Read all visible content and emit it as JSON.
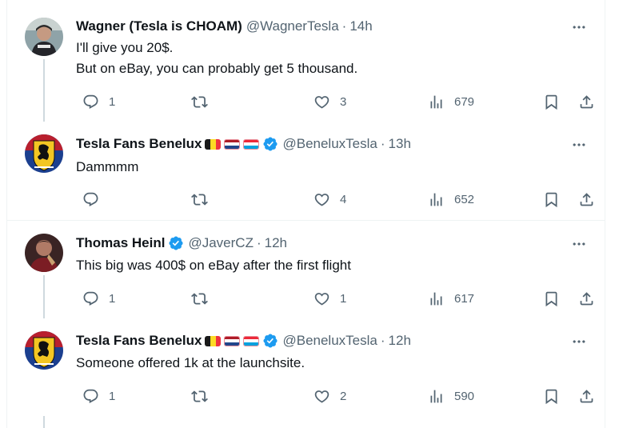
{
  "tweets": [
    {
      "name": "Wagner (Tesla is CHOAM)",
      "handle": "@WagnerTesla",
      "separator": "·",
      "time": "14h",
      "text": "I'll give you 20$.\nBut on eBay, you can probably get 5 thousand.",
      "replies": "1",
      "retweets": "",
      "likes": "3",
      "views": "679"
    },
    {
      "name": "Tesla Fans Benelux",
      "handle": "@BeneluxTesla",
      "separator": "·",
      "time": "13h",
      "text": "Dammmm",
      "replies": "",
      "retweets": "",
      "likes": "4",
      "views": "652"
    },
    {
      "name": "Thomas Heinl",
      "handle": "@JaverCZ",
      "separator": "·",
      "time": "12h",
      "text": "This big was 400$ on eBay after the first flight",
      "replies": "1",
      "retweets": "",
      "likes": "1",
      "views": "617"
    },
    {
      "name": "Tesla Fans Benelux",
      "handle": "@BeneluxTesla",
      "separator": "·",
      "time": "12h",
      "text": "Someone offered 1k at the launchsite.",
      "replies": "1",
      "retweets": "",
      "likes": "2",
      "views": "590"
    }
  ],
  "colors": {
    "text_primary": "#0f1419",
    "text_secondary": "#536471",
    "verified_blue": "#1d9bf0",
    "thread_line": "#cfd9de",
    "divider": "#eff3f4"
  },
  "icons": [
    "more-icon",
    "reply-icon",
    "retweet-icon",
    "like-icon",
    "views-icon",
    "bookmark-icon",
    "share-icon",
    "verified-badge-icon",
    "belgium-flag",
    "netherlands-flag",
    "luxembourg-flag"
  ]
}
